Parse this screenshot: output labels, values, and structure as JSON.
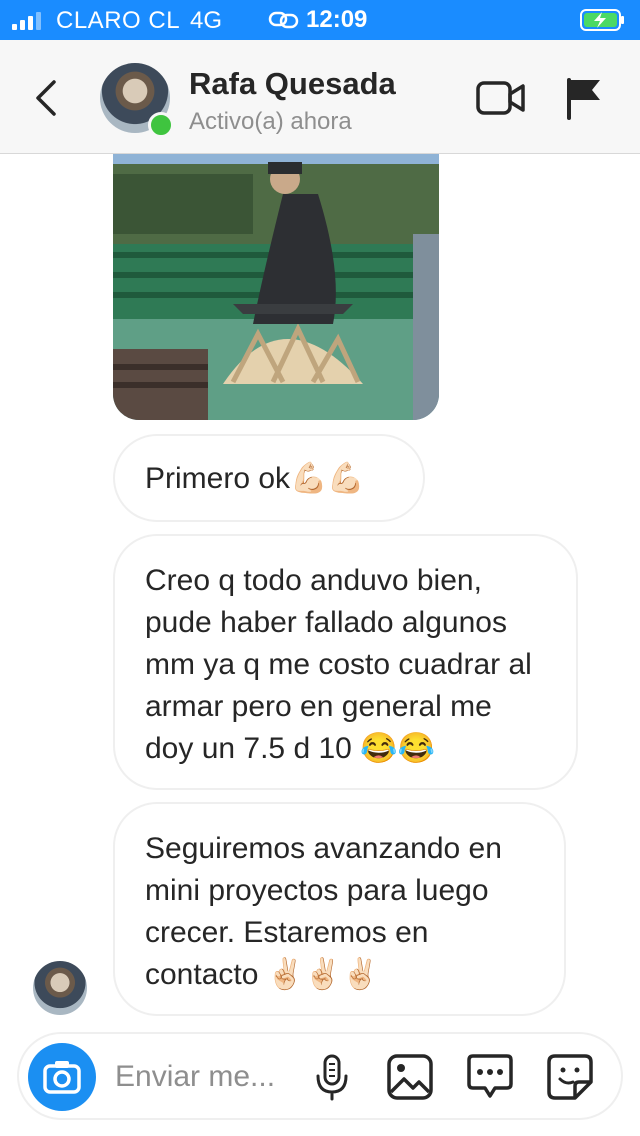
{
  "status_bar": {
    "carrier": "CLARO CL",
    "network": "4G",
    "time": "12:09",
    "battery_icon": "battery-charging-icon",
    "accent": "#1a8cff"
  },
  "header": {
    "contact_name": "Rafa Quesada",
    "contact_status": "Activo(a) ahora",
    "online_color": "#3fc43f",
    "icons": [
      "back-chevron-icon",
      "video-camera-icon",
      "flag-icon"
    ]
  },
  "messages": [
    {
      "type": "image",
      "description": "photo-attachment"
    },
    {
      "type": "text",
      "text": "Primero ok💪🏻💪🏻"
    },
    {
      "type": "text",
      "text": "Creo q todo anduvo bien, pude haber fallado algunos mm ya q me costo cuadrar al armar pero en general me doy un 7.5 d 10 😂😂"
    },
    {
      "type": "text",
      "text": "Seguiremos avanzando en mini proyectos para luego crecer. Estaremos en contacto ✌🏻✌🏻✌🏻"
    }
  ],
  "composer": {
    "placeholder": "Enviar me...",
    "icons": [
      "camera-icon",
      "microphone-icon",
      "gallery-icon",
      "chat-bubble-icon",
      "sticker-icon"
    ],
    "camera_color": "#1b8ff2"
  }
}
